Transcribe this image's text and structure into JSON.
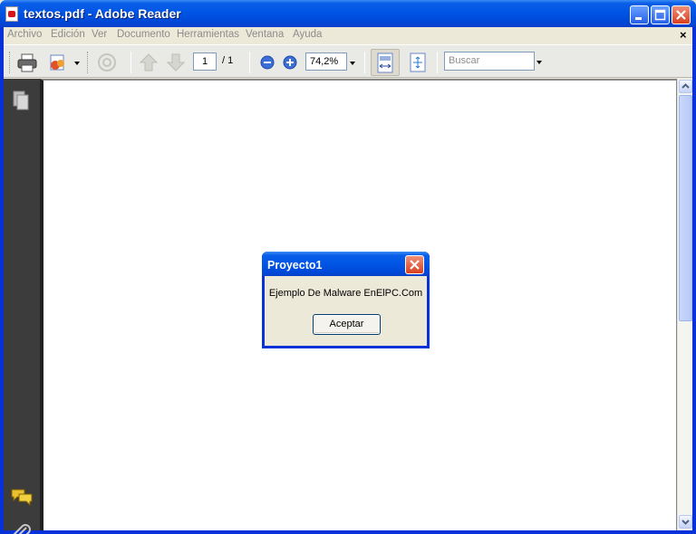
{
  "window": {
    "title": "textos.pdf - Adobe Reader"
  },
  "menu": {
    "items": [
      "Archivo",
      "Edición",
      "Ver",
      "Documento",
      "Herramientas",
      "Ventana",
      "Ayuda"
    ],
    "close_glyph": "×"
  },
  "toolbar": {
    "page_current": "1",
    "page_total": "/ 1",
    "zoom": "74,2%",
    "search_placeholder": "Buscar"
  },
  "dialog": {
    "title": "Proyecto1",
    "message": "Ejemplo De Malware EnElPC.Com",
    "button_label": "Aceptar"
  },
  "colors": {
    "title_bar": "#0055e5",
    "nav_panel": "#3c3c3c",
    "accent_close": "#d8401e"
  }
}
